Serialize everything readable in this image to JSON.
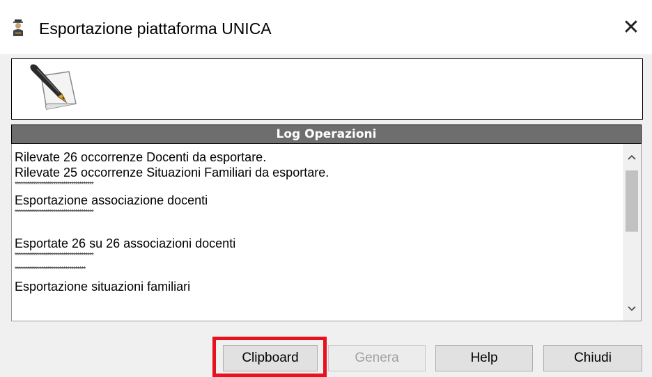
{
  "window": {
    "title": "Esportazione piattaforma UNICA",
    "close_glyph": "✕",
    "icon": "teacher-app-icon"
  },
  "header_panel": {
    "icon": "quill-document-icon"
  },
  "log": {
    "title": "Log Operazioni",
    "lines": [
      "Rilevate 26 occorrenze Docenti da esportare.",
      "Rilevate 25 occorrenze Situazioni Familiari da esportare.",
      "***************************************",
      "Esportazione associazione docenti",
      "***************************************",
      "",
      "Esportate 26 su 26 associazioni docenti",
      "***************************************",
      "***********************************",
      "Esportazione situazioni familiari"
    ]
  },
  "buttons": {
    "clipboard": "Clipboard",
    "genera": "Genera",
    "help": "Help",
    "chiudi": "Chiudi"
  },
  "colors": {
    "highlight": "#e8121f",
    "log_header_bg": "#6e6e6e"
  }
}
